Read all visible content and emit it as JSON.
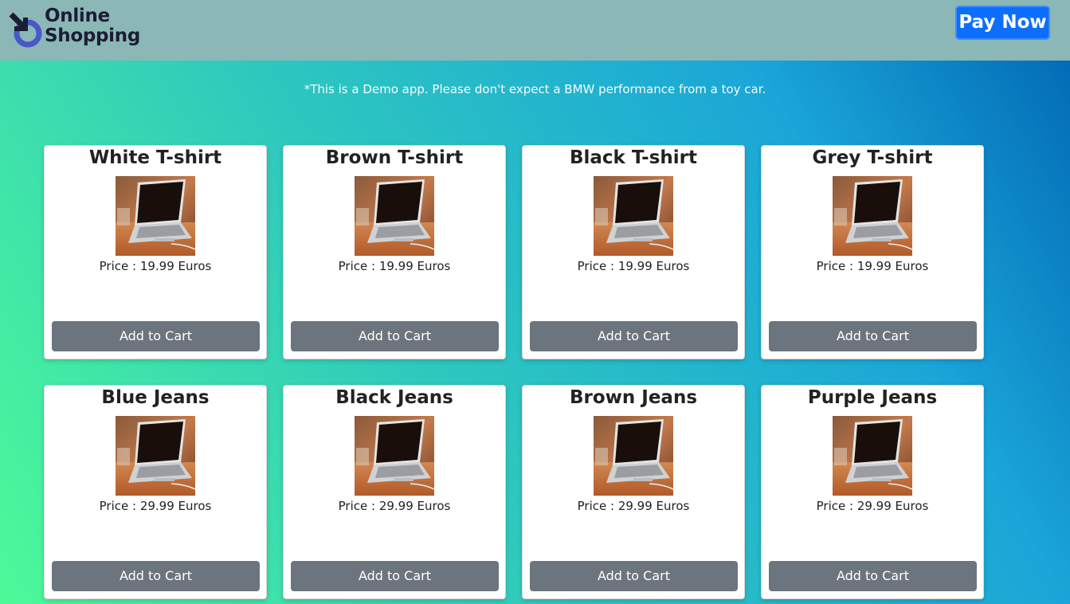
{
  "header": {
    "logo_line1": "Online",
    "logo_line2": "Shopping",
    "pay_label": "Pay Now",
    "bg_color": "#8bb7b7",
    "pay_color": "#0d6efd"
  },
  "notice": "*This is a Demo app. Please don't expect a BMW performance from a toy car.",
  "products": [
    {
      "name": "White T-shirt",
      "price": "Price : 19.99 Euros",
      "button": "Add to Cart",
      "image": "laptop-photo"
    },
    {
      "name": "Brown T-shirt",
      "price": "Price : 19.99 Euros",
      "button": "Add to Cart",
      "image": "laptop-photo"
    },
    {
      "name": "Black T-shirt",
      "price": "Price : 19.99 Euros",
      "button": "Add to Cart",
      "image": "laptop-photo"
    },
    {
      "name": "Grey T-shirt",
      "price": "Price : 19.99 Euros",
      "button": "Add to Cart",
      "image": "laptop-photo"
    },
    {
      "name": "Blue Jeans",
      "price": "Price : 29.99 Euros",
      "button": "Add to Cart",
      "image": "laptop-photo"
    },
    {
      "name": "Black Jeans",
      "price": "Price : 29.99 Euros",
      "button": "Add to Cart",
      "image": "laptop-photo"
    },
    {
      "name": "Brown Jeans",
      "price": "Price : 29.99 Euros",
      "button": "Add to Cart",
      "image": "laptop-photo"
    },
    {
      "name": "Purple Jeans",
      "price": "Price : 29.99 Euros",
      "button": "Add to Cart",
      "image": "laptop-photo"
    }
  ],
  "cart_button_color": "#6c757d"
}
